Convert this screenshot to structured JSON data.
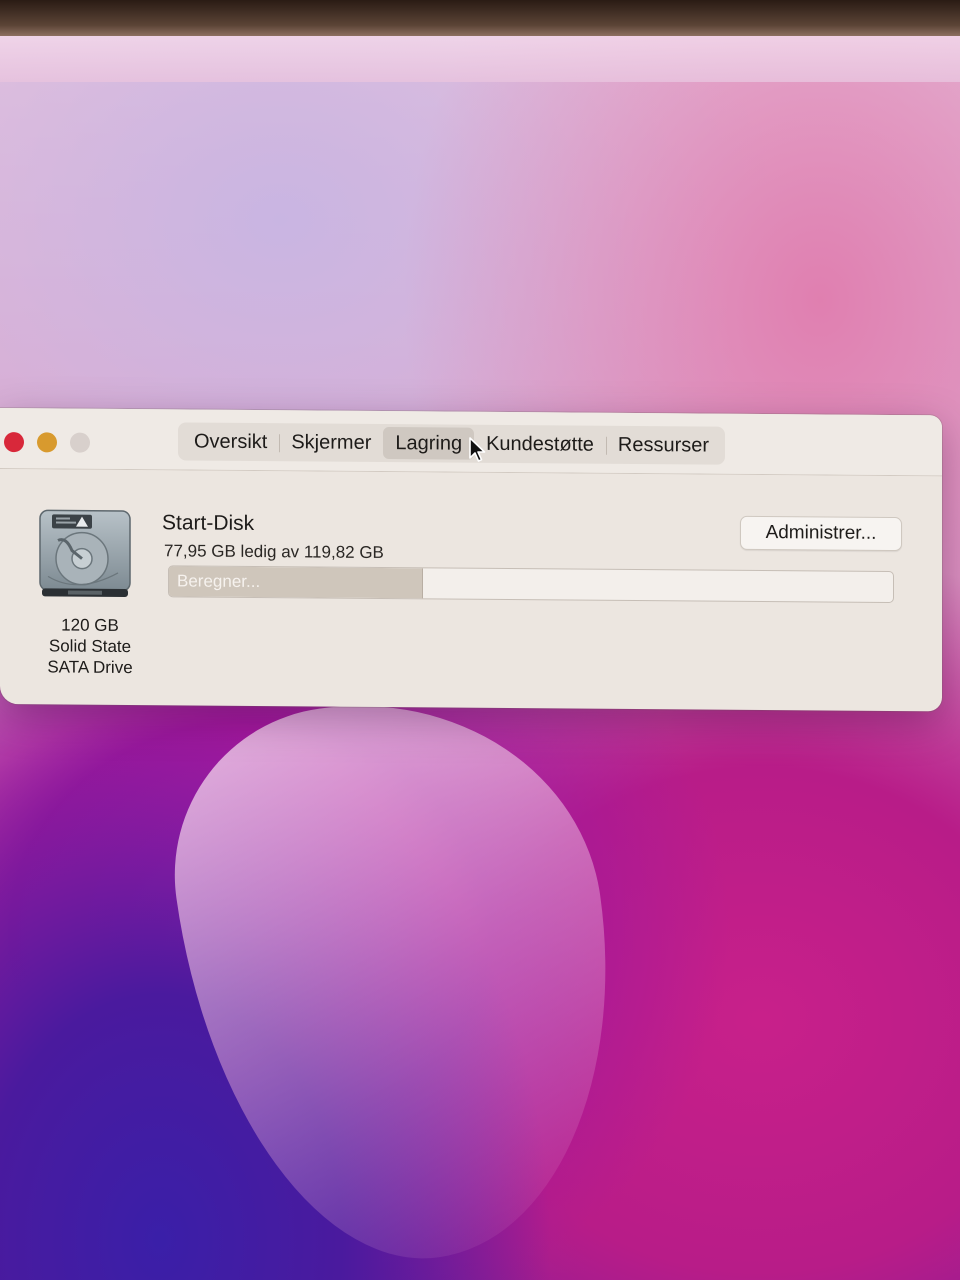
{
  "colors": {
    "close": "#d8283a",
    "minimize": "#d89a2e",
    "zoom": "#d8d0cc",
    "window_bg": "#ece6e0",
    "storage_fill": "#cfc6bb"
  },
  "tabs": [
    {
      "label": "Oversikt",
      "active": false
    },
    {
      "label": "Skjermer",
      "active": false
    },
    {
      "label": "Lagring",
      "active": true
    },
    {
      "label": "Kundestøtte",
      "active": false
    },
    {
      "label": "Ressurser",
      "active": false
    }
  ],
  "disk": {
    "icon": "internal-drive-icon",
    "capacity": "120 GB",
    "type_line1": "Solid State",
    "type_line2": "SATA Drive",
    "name": "Start-Disk",
    "free_text": "77,95 GB ledig av 119,82 GB",
    "manage_label": "Administrer...",
    "storage_status": "Beregner...",
    "used_fraction": 0.35
  },
  "cursor": {
    "icon": "arrow-pointer-icon"
  }
}
